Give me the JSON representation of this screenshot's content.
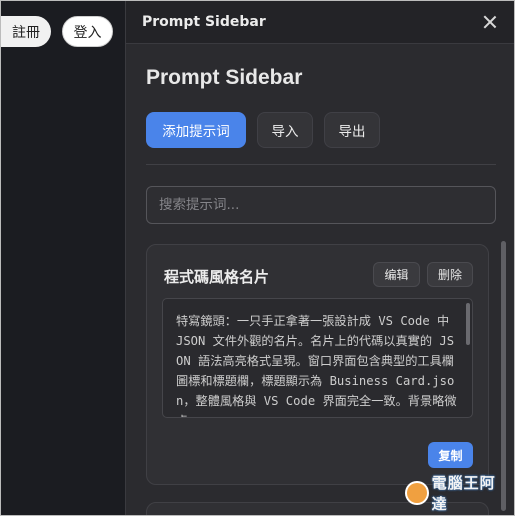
{
  "background_page": {
    "register_label": "註冊",
    "login_label": "登入"
  },
  "sidebar": {
    "header_title": "Prompt Sidebar",
    "title": "Prompt Sidebar",
    "add_prompt_label": "添加提示词",
    "import_label": "导入",
    "export_label": "导出",
    "search_placeholder": "搜索提示词...",
    "prompts": [
      {
        "title": "程式碼風格名片",
        "edit_label": "编辑",
        "delete_label": "删除",
        "text": "特寫鏡頭：一只手正拿著一張設計成 VS Code 中 JSON 文件外觀的名片。名片上的代碼以真實的 JSON 語法高亮格式呈現。窗口界面包含典型的工具欄圖標和標題欄，標題顯示為 Business Card.json，整體風格與 VS Code 界面完全一致。背景略微虛",
        "copy_label": "复制"
      }
    ]
  },
  "watermark": {
    "text": "電腦王阿達"
  }
}
